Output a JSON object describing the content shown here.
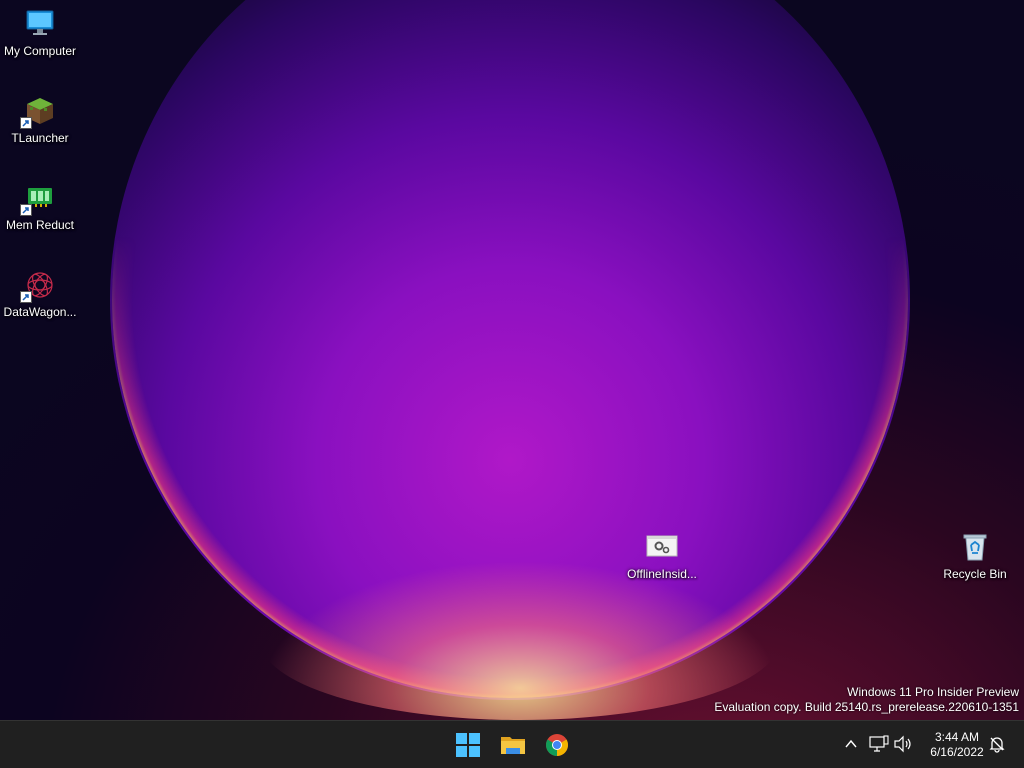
{
  "desktop": {
    "icons": [
      {
        "label": "My Computer",
        "icon": "computer-icon"
      },
      {
        "label": "TLauncher",
        "icon": "tlauncher-icon"
      },
      {
        "label": "Mem Reduct",
        "icon": "mem-reduct-icon"
      },
      {
        "label": "DataWagon...",
        "icon": "datawagon-icon"
      },
      {
        "label": "OfflineInsid...",
        "icon": "batch-file-icon"
      },
      {
        "label": "Recycle Bin",
        "icon": "recycle-bin-icon"
      }
    ]
  },
  "watermark": {
    "line1": "Windows 11 Pro Insider Preview",
    "line2": "Evaluation copy. Build 25140.rs_prerelease.220610-1351"
  },
  "taskbar": {
    "apps": [
      {
        "name": "Start",
        "icon": "windows-start-icon"
      },
      {
        "name": "File Explorer",
        "icon": "file-explorer-icon"
      },
      {
        "name": "Google Chrome",
        "icon": "chrome-icon"
      }
    ],
    "tray": {
      "time": "3:44 AM",
      "date": "6/16/2022"
    }
  },
  "colors": {
    "taskbar": "#202020",
    "start_blue": "#4cc2ff",
    "folder_yellow": "#f4c542"
  }
}
